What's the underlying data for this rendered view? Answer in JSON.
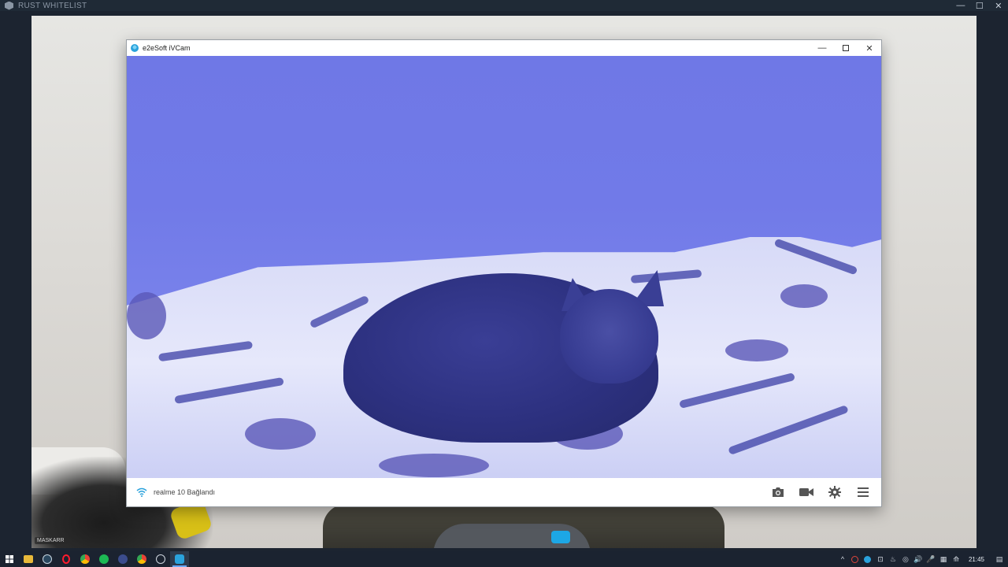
{
  "host_window": {
    "title": "RUST WHITELIST",
    "controls": {
      "minimize": "—",
      "maximize": "☐",
      "close": "✕"
    }
  },
  "background": {
    "name_tag": "MASKARR"
  },
  "ivcam": {
    "title": "e2eSoft iVCam",
    "controls": {
      "minimize": "—",
      "close": "✕"
    },
    "status": {
      "text": "realme 10 Bağlandı"
    },
    "colors": {
      "view_tint": "#7078e8",
      "accent": "#2aa2dc"
    }
  },
  "taskbar": {
    "items": [
      {
        "name": "start-icon",
        "glyph": "⊞"
      },
      {
        "name": "file-explorer-icon",
        "glyph": "■"
      },
      {
        "name": "steam-icon",
        "glyph": "◉"
      },
      {
        "name": "opera-icon",
        "glyph": "O"
      },
      {
        "name": "chrome-icon",
        "glyph": "◎"
      },
      {
        "name": "spotify-icon",
        "glyph": "●"
      },
      {
        "name": "app-icon",
        "glyph": "◆"
      },
      {
        "name": "chrome-2-icon",
        "glyph": "◎"
      },
      {
        "name": "rust-icon",
        "glyph": "◌"
      },
      {
        "name": "ivcam-icon",
        "glyph": "▣",
        "active": true
      }
    ],
    "tray_icons": [
      "^",
      "⊘",
      "●",
      "⊡",
      "♨",
      "◎",
      "🔊",
      "🎤",
      "▦",
      "⟰"
    ],
    "clock": "21:45",
    "notification_glyph": "▤"
  }
}
